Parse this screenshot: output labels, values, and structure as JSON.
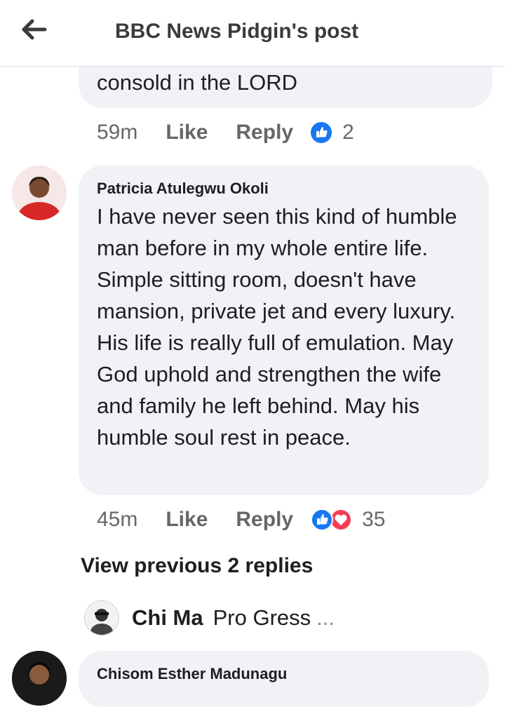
{
  "header": {
    "title": "BBC News Pidgin's post",
    "back_icon": "arrow-left-icon"
  },
  "comment_partial": {
    "text": "consold in the LORD",
    "time": "59m",
    "like": "Like",
    "reply": "Reply",
    "reaction_count": "2"
  },
  "comment_main": {
    "author": "Patricia Atulegwu Okoli",
    "text": "I have never seen this kind of humble man before in my whole entire life. Simple sitting room, doesn't have mansion, private jet and every luxury. His life is really full of emulation. May God uphold and strengthen the wife and family he left behind. May his humble soul rest in peace.",
    "time": "45m",
    "like": "Like",
    "reply": "Reply",
    "reaction_count": "35"
  },
  "view_previous": "View previous 2 replies",
  "latest_reply": {
    "author": "Chi Ma",
    "text": "Pro Gress",
    "ellipsis": "..."
  },
  "next_comment": {
    "author": "Chisom Esther Madunagu"
  },
  "colors": {
    "like_blue": "#1877f2",
    "love_red": "#f33e58",
    "bubble_bg": "#f0f2f5",
    "meta_gray": "#65676b"
  }
}
